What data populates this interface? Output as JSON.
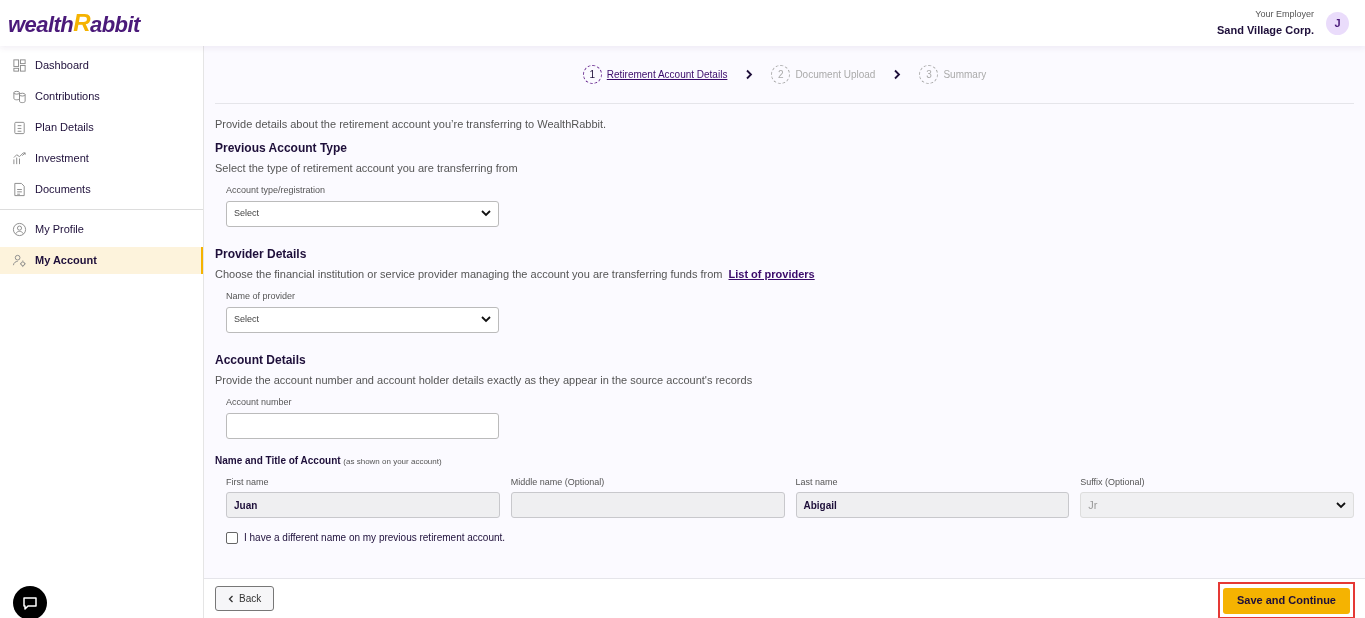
{
  "logo": {
    "left": "wealth",
    "mark": "R",
    "right": "abbit"
  },
  "header": {
    "employer_label": "Your Employer",
    "employer_name": "Sand Village Corp.",
    "avatar": "J"
  },
  "sidebar": {
    "main_items": [
      {
        "label": "Dashboard",
        "selected": false
      },
      {
        "label": "Contributions",
        "selected": false
      },
      {
        "label": "Plan Details",
        "selected": false
      },
      {
        "label": "Investment",
        "selected": false
      },
      {
        "label": "Documents",
        "selected": false
      }
    ],
    "account_items": [
      {
        "label": "My Profile",
        "selected": false
      },
      {
        "label": "My Account",
        "selected": true
      }
    ]
  },
  "steps": [
    {
      "number": "1",
      "label": "Retirement Account Details",
      "selected": true
    },
    {
      "number": "2",
      "label": "Document Upload",
      "selected": false
    },
    {
      "number": "3",
      "label": "Summary",
      "selected": false
    }
  ],
  "intro": "Provide details about the retirement account you’re transferring to WealthRabbit.",
  "sections": [
    {
      "title": "Previous Account Type",
      "description": "Select the type of retirement account you are transferring from",
      "field": {
        "kind": "select",
        "label": "Account type/registration",
        "value": "Select"
      }
    },
    {
      "title": "Provider Details",
      "description": "Choose the financial institution or service provider managing the account you are transferring funds from",
      "link": "List of providers",
      "field": {
        "kind": "select",
        "label": "Name of provider",
        "value": "Select"
      }
    },
    {
      "title": "Account Details",
      "description": "Provide the account number and account holder details exactly as they appear in the source account's records",
      "field": {
        "kind": "text",
        "label": "Account number"
      }
    }
  ],
  "name_section": {
    "title": "Name and Title of Account",
    "note": "(as shown on your account)",
    "fields": [
      {
        "kind": "text",
        "label": "First name",
        "value": "Juan"
      },
      {
        "kind": "text",
        "label": "Middle name (Optional)"
      },
      {
        "kind": "text",
        "label": "Last name",
        "value": "Abigail"
      },
      {
        "kind": "select",
        "label": "Suffix (Optional)",
        "placeholder": "Jr"
      }
    ],
    "checkbox": {
      "label": "I have a different name on my previous retirement account.",
      "checked": false
    }
  },
  "footer": {
    "back": "Back",
    "save": "Save and Continue"
  }
}
